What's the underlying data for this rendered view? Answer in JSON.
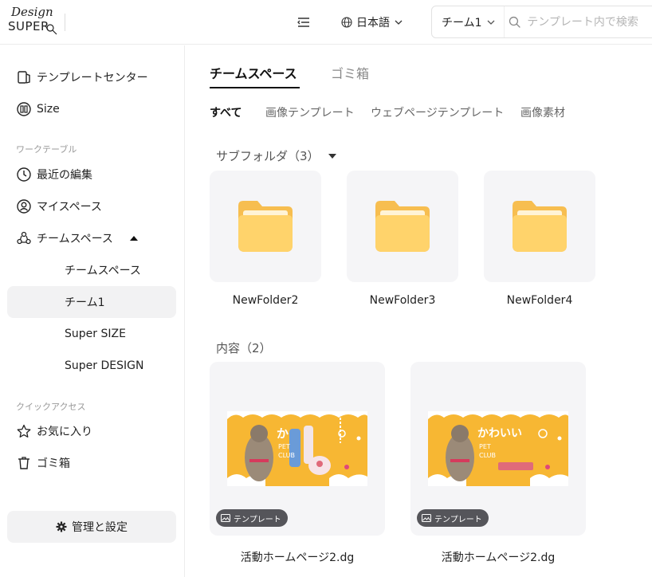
{
  "header": {
    "logo_top": "Design",
    "logo_bottom": "SUPER",
    "language": "日本語",
    "team_select": "チーム1",
    "search_placeholder": "テンプレート内で検索"
  },
  "sidebar": {
    "template_center": "テンプレートセンター",
    "size": "Size",
    "worktable_label": "ワークテーブル",
    "recent": "最近の編集",
    "my_space": "マイスペース",
    "team_space": "チームスペース",
    "team_items": [
      "チームスペース",
      "チーム1",
      "Super SIZE",
      "Super DESIGN"
    ],
    "quick_access_label": "クイックアクセス",
    "favorites": "お気に入り",
    "trash": "ゴミ箱",
    "settings": "管理と設定"
  },
  "main": {
    "tabs": [
      "チームスペース",
      "ゴミ箱"
    ],
    "filters": [
      "すべて",
      "画像テンプレート",
      "ウェブページテンプレート",
      "画像素材"
    ],
    "subfolder_title": "サブフォルダ（3）",
    "folders": [
      "NewFolder2",
      "NewFolder3",
      "NewFolder4"
    ],
    "content_title": "内容（2）",
    "contents": [
      {
        "badge": "テンプレート",
        "name": "活動ホームページ2.dg",
        "thumb_title": "か",
        "thumb_sub1": "PET",
        "thumb_sub2": "CLUB"
      },
      {
        "badge": "テンプレート",
        "name": "活動ホームページ2.dg",
        "thumb_title": "かわいい",
        "thumb_sub1": "PET",
        "thumb_sub2": "CLUB"
      }
    ]
  },
  "colors": {
    "folder": "#ffd36b",
    "folder_back": "#f7be50",
    "thumb_bg": "#f7b733"
  }
}
